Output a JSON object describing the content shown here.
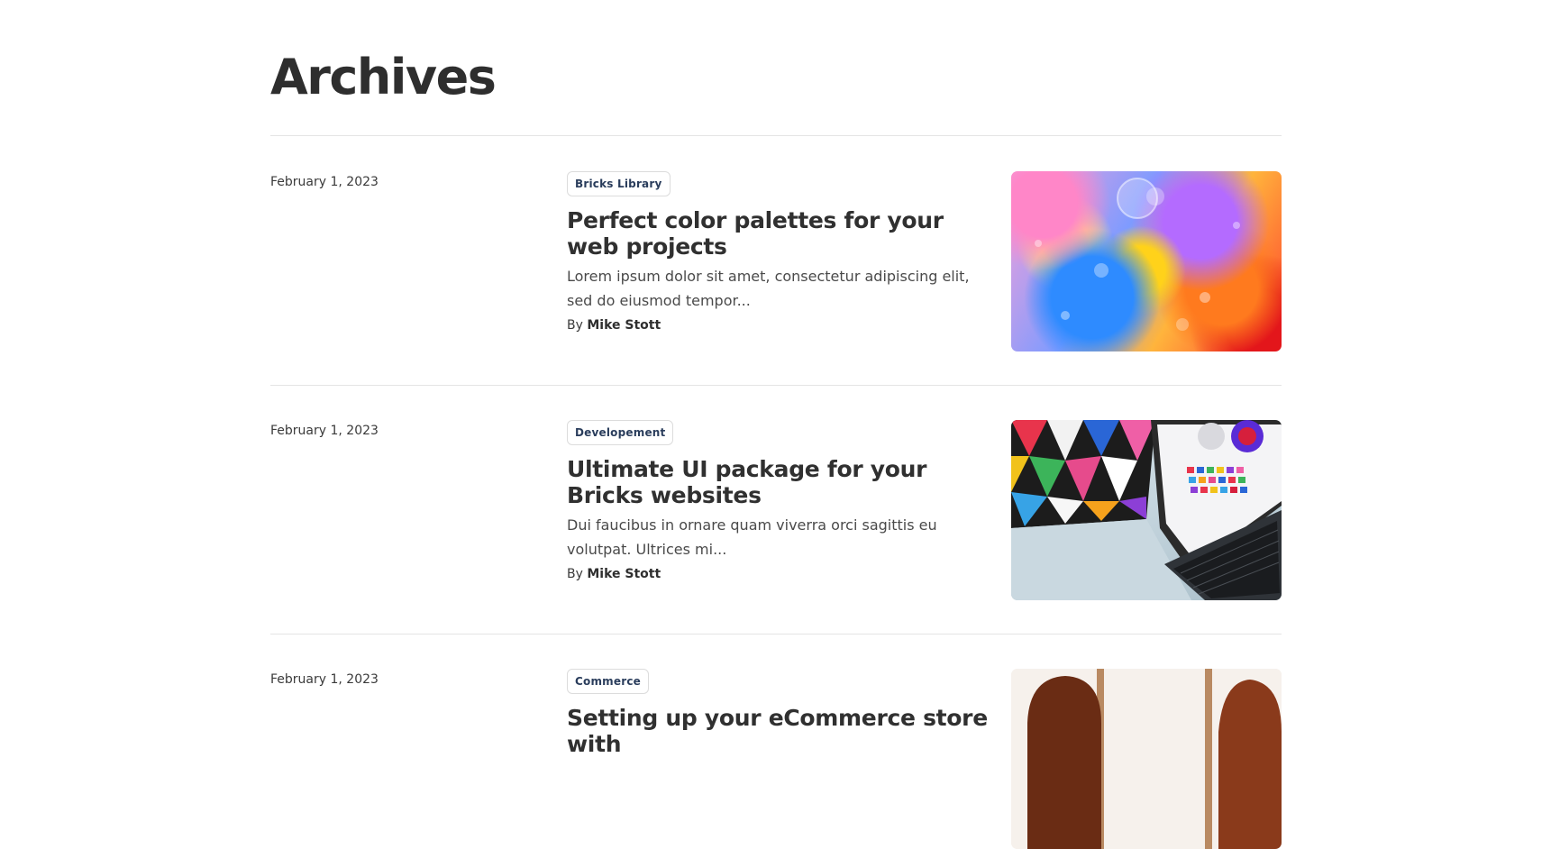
{
  "page": {
    "title": "Archives"
  },
  "posts": [
    {
      "date": "February 1, 2023",
      "category": "Bricks Library",
      "title": "Perfect color palettes for your web projects",
      "excerpt": "Lorem ipsum dolor sit amet, consectetur adipiscing elit, sed do eiusmod tempor...",
      "author_prefix": "By",
      "author": "Mike Stott",
      "image": "colorful-abstract-oil-bubbles-image"
    },
    {
      "date": "February 1, 2023",
      "category": "Developement",
      "title": "Ultimate UI package for your Bricks websites",
      "excerpt": "Dui faucibus in ornare quam viverra orci sagittis eu volutpat. Ultrices mi...",
      "author_prefix": "By",
      "author": "Mike Stott",
      "image": "laptop-with-ui-palette-image"
    },
    {
      "date": "February 1, 2023",
      "category": "Commerce",
      "title": "Setting up your eCommerce store with",
      "image": "two-women-commerce-image"
    }
  ]
}
